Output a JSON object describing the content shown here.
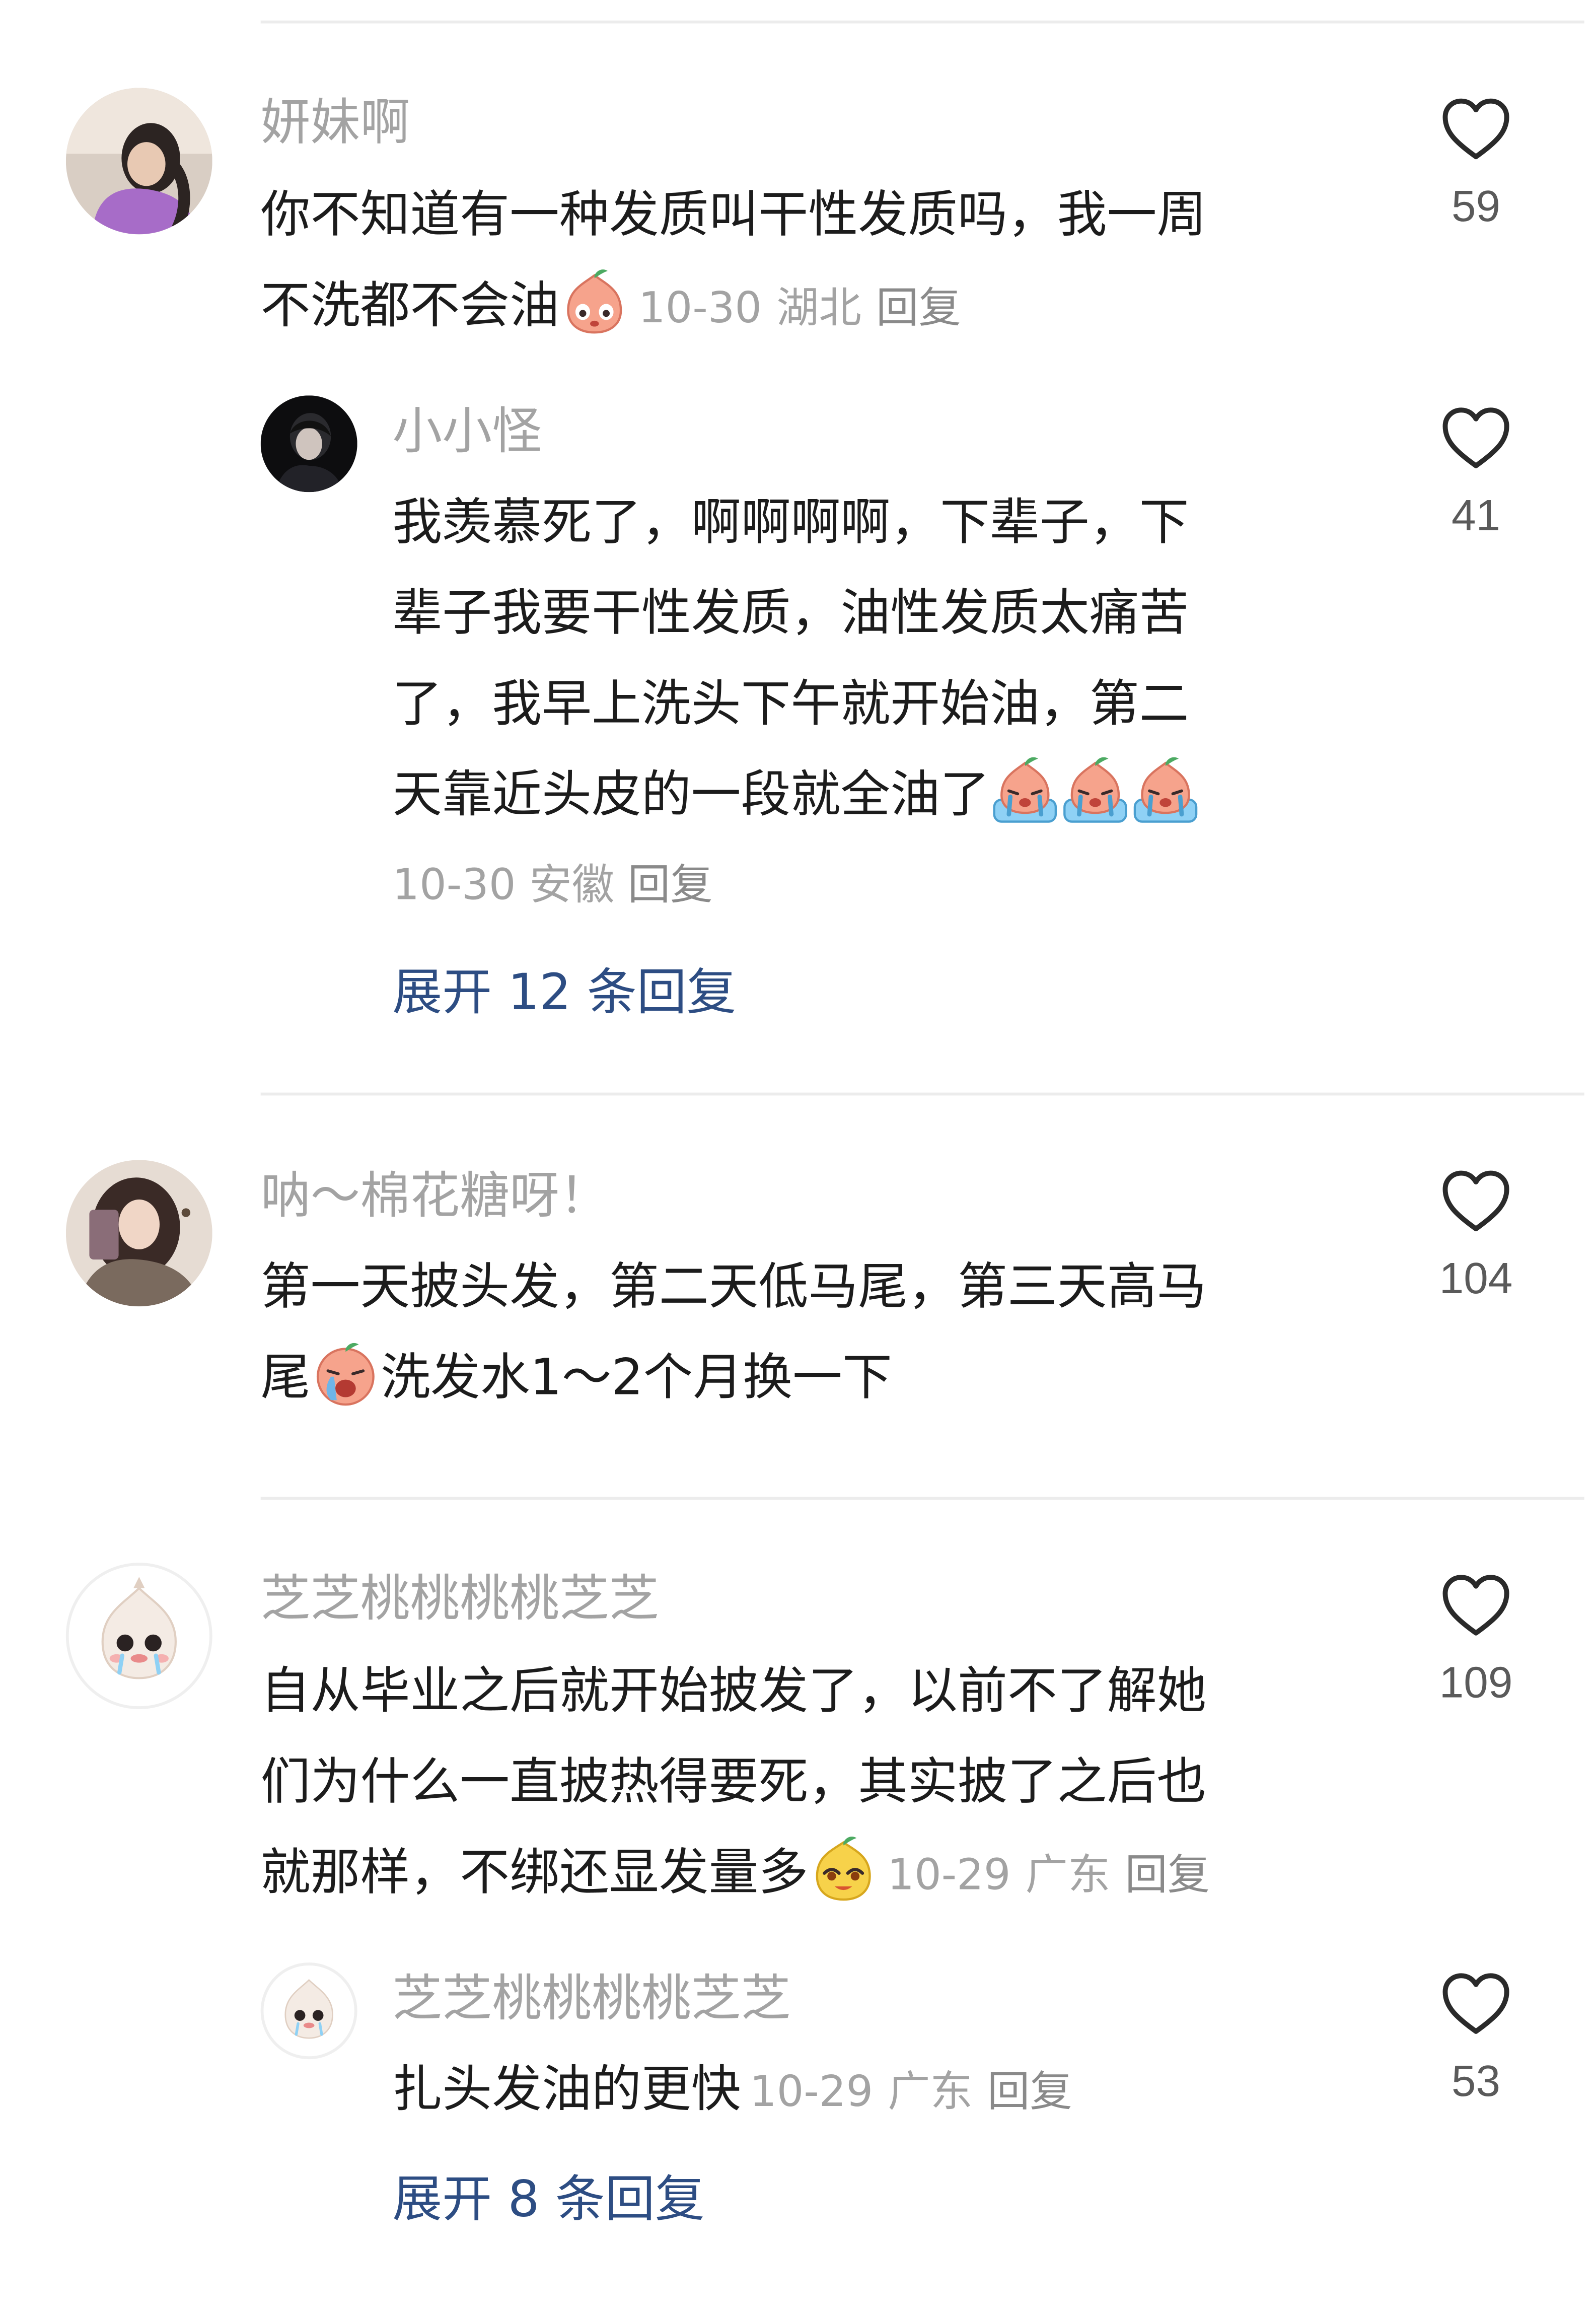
{
  "comments": [
    {
      "username": "妍妹啊",
      "lines": [
        "你不知道有一种发质叫干性发质吗，我一周",
        "不洗都不会油"
      ],
      "date": "10-30",
      "location": "湖北",
      "reply_label": "回复",
      "likes": "59",
      "emojis": [
        "sweat-peach-emoji"
      ],
      "replies": [
        {
          "username": "小小怪",
          "lines": [
            "我羡慕死了，啊啊啊啊，下辈子，下",
            "辈子我要干性发质，油性发质太痛苦",
            "了，我早上洗头下午就开始油，第二",
            "天靠近头皮的一段就全油了"
          ],
          "date": "10-30",
          "location": "安徽",
          "reply_label": "回复",
          "likes": "41",
          "emojis": [
            "crying-peach-emoji",
            "crying-peach-emoji",
            "crying-peach-emoji"
          ]
        }
      ],
      "expand_label": "展开 12 条回复"
    },
    {
      "username": "呐～棉花糖呀！",
      "lines": [
        "第一天披头发，第二天低马尾，第三天高马",
        "尾",
        "洗发水1～2个月换一下"
      ],
      "likes": "104",
      "emojis": [
        "crying-face-emoji"
      ]
    },
    {
      "username": "芝芝桃桃桃桃芝芝",
      "lines": [
        "自从毕业之后就开始披发了，以前不了解她",
        "们为什么一直披热得要死，其实披了之后也",
        "就那样，不绑还显发量多"
      ],
      "date": "10-29",
      "location": "广东",
      "reply_label": "回复",
      "likes": "109",
      "emojis": [
        "smug-peach-emoji"
      ],
      "replies": [
        {
          "username": "芝芝桃桃桃桃芝芝",
          "lines": [
            "扎头发油的更快"
          ],
          "date": "10-29",
          "location": "广东",
          "reply_label": "回复",
          "likes": "53"
        }
      ],
      "expand_label": "展开 8 条回复"
    }
  ]
}
